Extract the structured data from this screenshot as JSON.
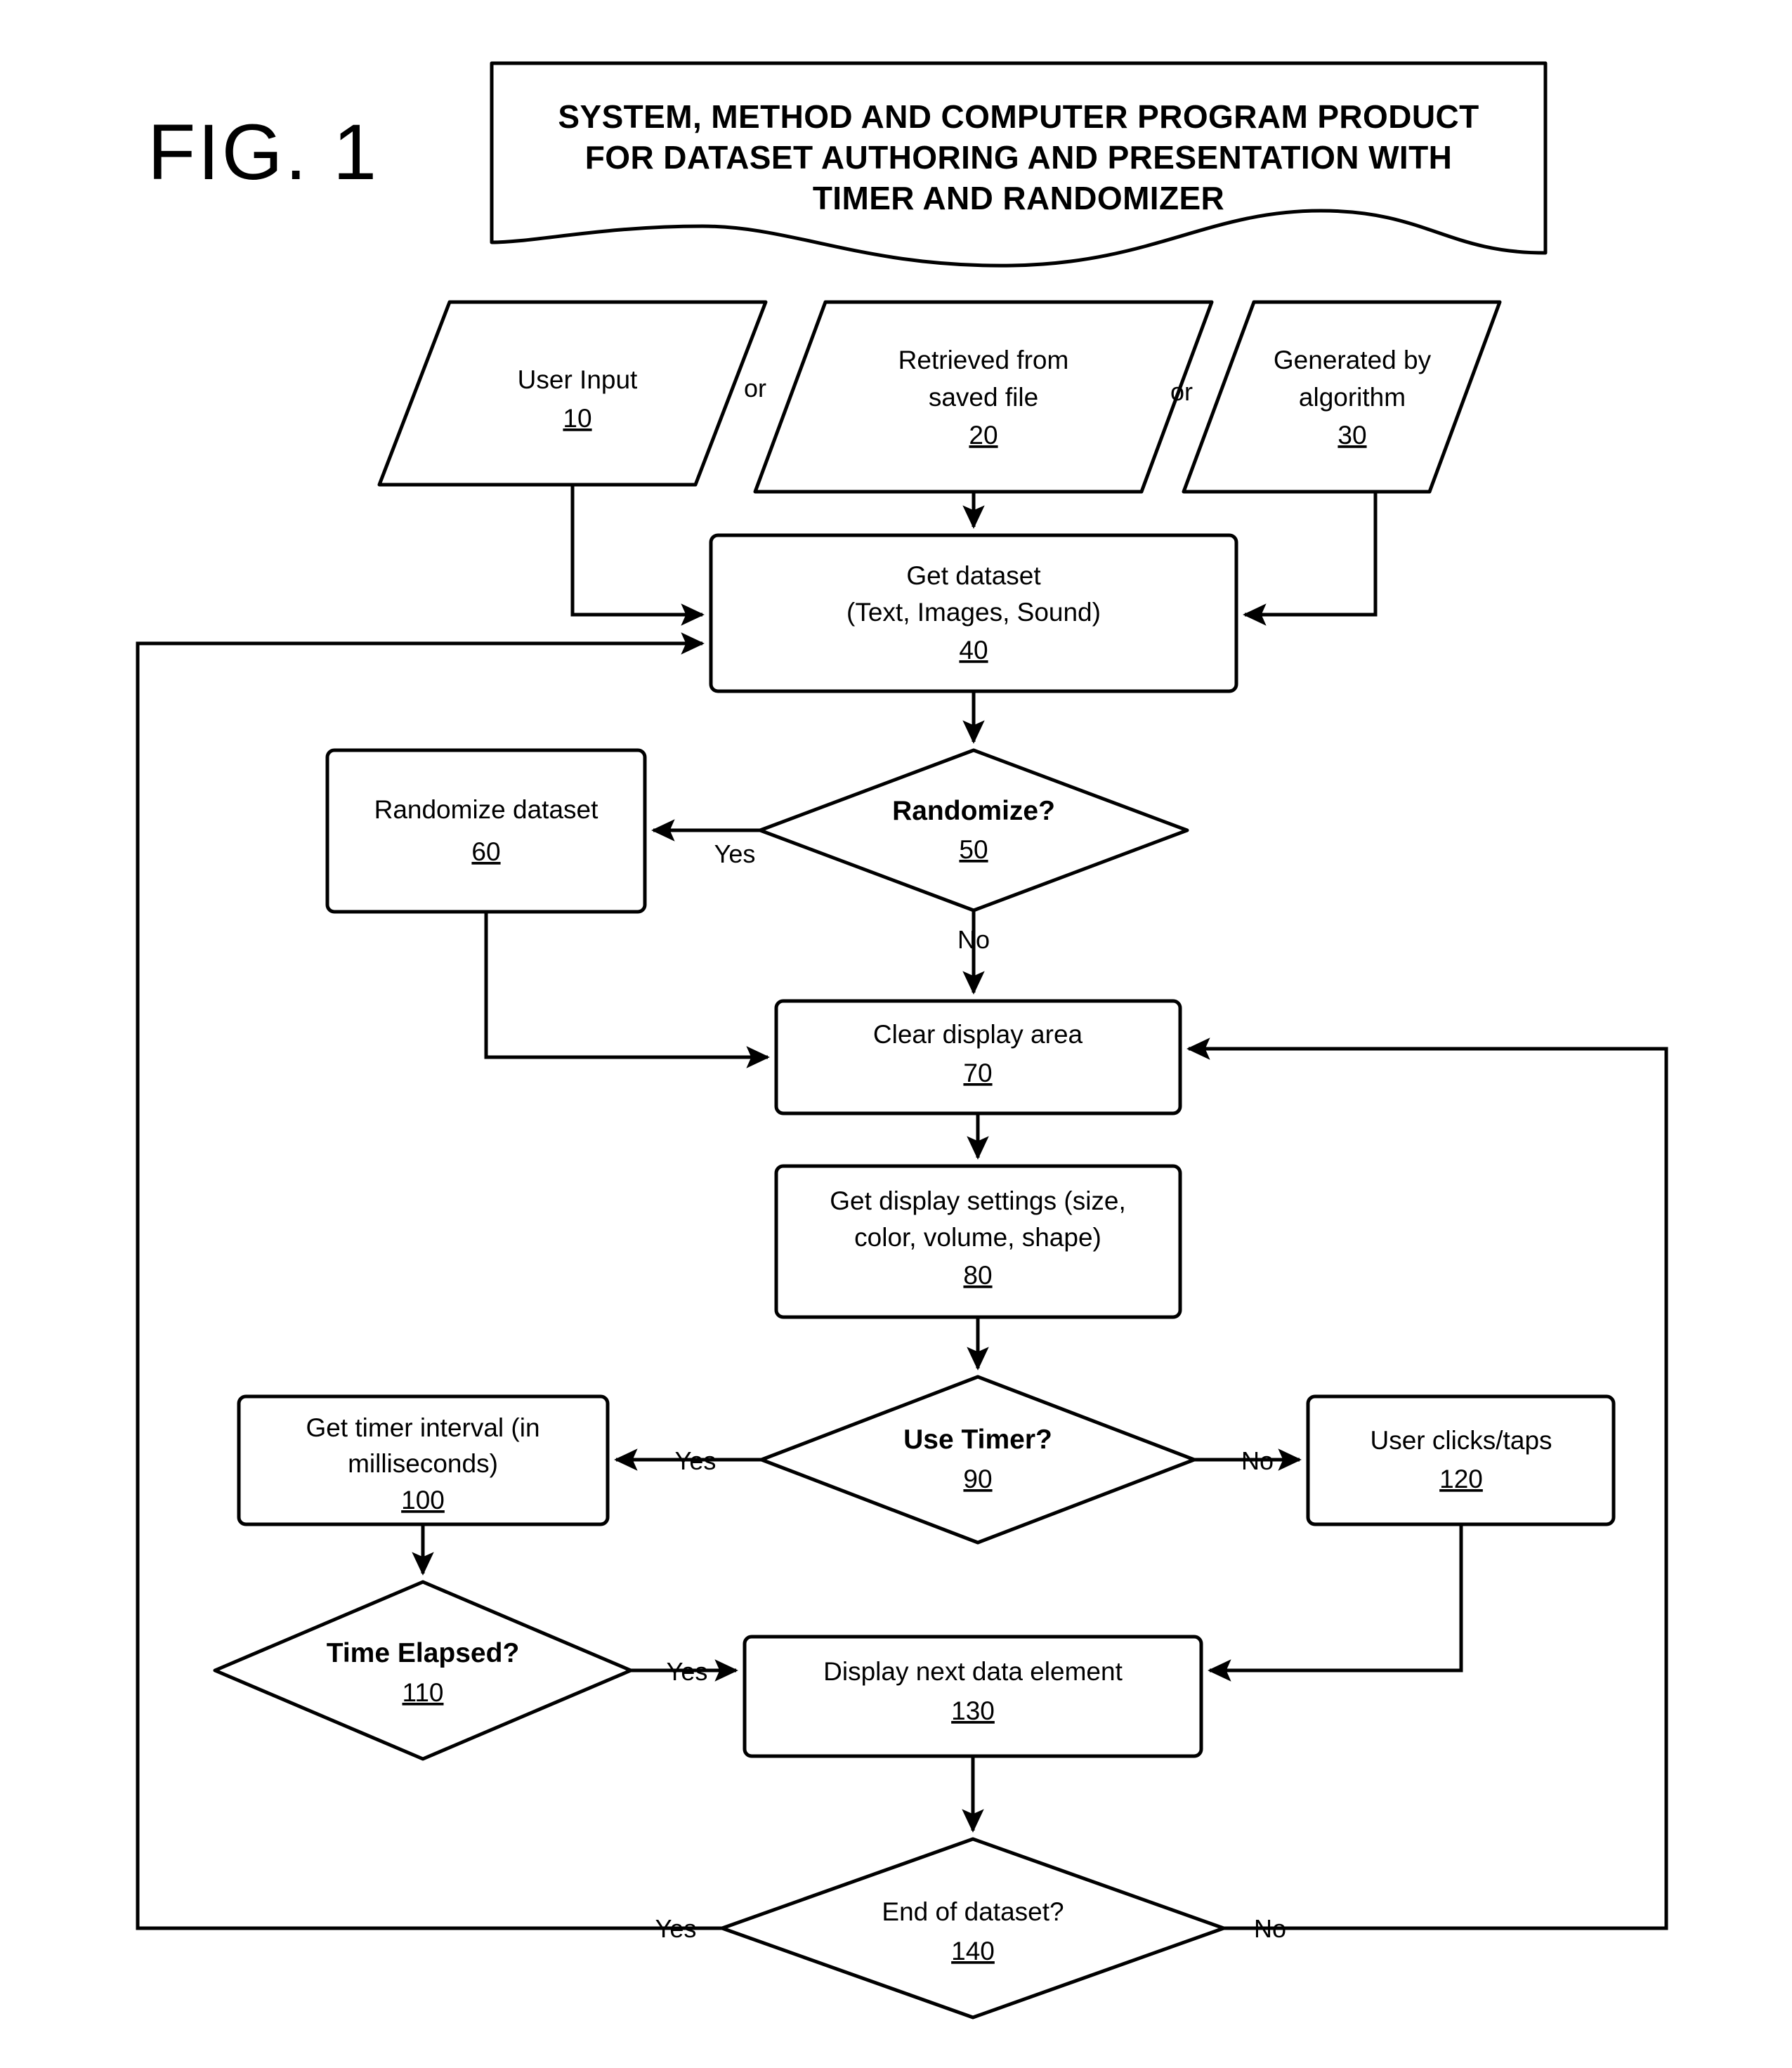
{
  "figure": {
    "label": "FIG. 1",
    "title_lines": [
      "SYSTEM, METHOD AND COMPUTER PROGRAM PRODUCT",
      "FOR DATASET AUTHORING AND PRESENTATION WITH",
      "TIMER AND RANDOMIZER"
    ]
  },
  "inputs": {
    "node_10": {
      "line1": "User Input",
      "ref": "10"
    },
    "or_1": "or",
    "node_20": {
      "line1": "Retrieved from",
      "line2": "saved file",
      "ref": "20"
    },
    "or_2": "or",
    "node_30": {
      "line1": "Generated by",
      "line2": "algorithm",
      "ref": "30"
    }
  },
  "process": {
    "node_40": {
      "line1": "Get dataset",
      "line2": "(Text, Images, Sound)",
      "ref": "40"
    },
    "node_50": {
      "line1": "Randomize?",
      "ref": "50"
    },
    "node_60": {
      "line1": "Randomize dataset",
      "ref": "60"
    },
    "node_70": {
      "line1": "Clear display area",
      "ref": "70"
    },
    "node_80": {
      "line1": "Get display settings (size,",
      "line2": "color, volume, shape)",
      "ref": "80"
    },
    "node_90": {
      "line1": "Use Timer?",
      "ref": "90"
    },
    "node_100": {
      "line1": "Get timer interval (in",
      "line2": "milliseconds)",
      "ref": "100"
    },
    "node_110": {
      "line1": "Time Elapsed?",
      "ref": "110"
    },
    "node_120": {
      "line1": "User clicks/taps",
      "ref": "120"
    },
    "node_130": {
      "line1": "Display next data element",
      "ref": "130"
    },
    "node_140": {
      "line1": "End of dataset?",
      "ref": "140"
    }
  },
  "edges": {
    "randomize_yes": "Yes",
    "randomize_no": "No",
    "timer_yes": "Yes",
    "timer_no": "No",
    "elapsed_yes": "Yes",
    "end_yes": "Yes",
    "end_no": "No"
  },
  "colors": {
    "stroke": "#000000",
    "fill": "#ffffff",
    "background": "#ffffff"
  }
}
